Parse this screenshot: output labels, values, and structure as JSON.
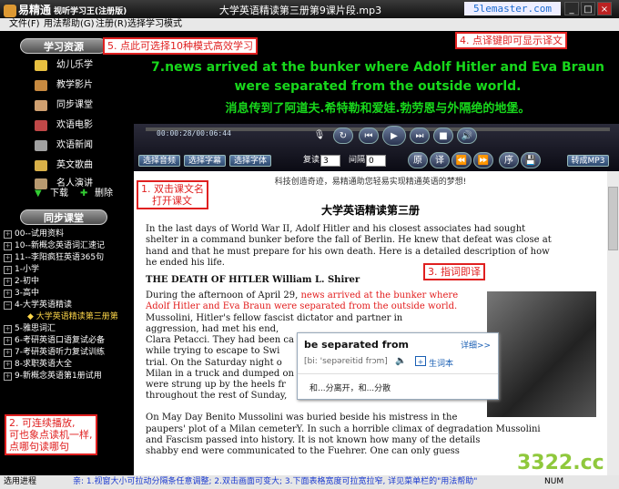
{
  "window": {
    "app_name": "易精通",
    "app_subtitle": "视听学习王(注册版)",
    "title": "大学英语精读第三册第9课片段.mp3",
    "site_badge": "5lemaster.com",
    "min": "_",
    "max": "□",
    "close": "×"
  },
  "menu": [
    "文件(F)",
    "用法帮助(G)",
    "注册(R)",
    "选择学习模式"
  ],
  "sidebar": {
    "learning_header": "学习资源",
    "items": [
      {
        "label": "幼儿乐学",
        "icon": "star-icon"
      },
      {
        "label": "教学影片",
        "icon": "film-icon"
      },
      {
        "label": "同步课堂",
        "icon": "book-icon"
      },
      {
        "label": "欢语电影",
        "icon": "movie-icon"
      },
      {
        "label": "欢语新闻",
        "icon": "news-icon"
      },
      {
        "label": "英文歌曲",
        "icon": "music-icon"
      },
      {
        "label": "名人演讲",
        "icon": "person-icon"
      }
    ],
    "download": "下载",
    "delete": "删除",
    "sync_header": "同步课堂",
    "tree": [
      "00--试用资料",
      "10--新概念英语词汇速记",
      "11--李阳疯狂英语365句",
      "1-小学",
      "2-初中",
      "3-高中",
      "4-大学英语精读",
      "大学英语精读第三册第",
      "5-雅思词汇",
      "6-考研英语口语复试必备",
      "7-考研英语听力复试训练",
      "8-求职英语大全",
      "9-新概念英语第1册试用"
    ]
  },
  "video": {
    "subtitle_en_1": "7.news arrived at the bunker where Adolf Hitler and Eva Braun",
    "subtitle_en_2": "were separated from the outside world.",
    "subtitle_cn": "消息传到了阿道夫.希特勒和爱娃.勃劳恩与外隔绝的地堡。"
  },
  "controls": {
    "time": "00:00:28/00:06:44",
    "btn_audio": "选择音频",
    "btn_subtitle": "选择字幕",
    "btn_font": "选择字体",
    "repeat_label": "复读",
    "repeat_value": "3",
    "interval_label": "间隔",
    "interval_value": "0",
    "original": "原",
    "translate": "译",
    "seq": "序",
    "convert": "转成MP3"
  },
  "content": {
    "slogan": "科技创造奇迹，易精通助您轻易实现精通英语的梦想!",
    "heading": "大学英语精读第三册",
    "lines": [
      "In the last days of World War II, Adolf Hitler and his closest associates had sought",
      "shelter in a command bunker before the fall of Berlin. He knew that defeat was close at",
      "hand and that he must prepare for his own death. Here is a detailed description of how",
      "he ended his life."
    ],
    "section_title": "THE DEATH OF HITLER William L. Shirer",
    "p2_prefix": "During the afternoon of April 29, ",
    "p2_red": "news arrived at the bunker where",
    "p2_red2": "Adolf Hitler and Eva Braun were separated from the outside world.",
    "p2_lines": [
      "Mussolini, Hitler's fellow fascist dictator and partner in",
      "aggression, had met his end,",
      "Clara Petacci. They had been ca",
      "while trying to escape to Swi",
      "trial. On the Saturday night o",
      "Milan in a truck and dumped on",
      "were strung up by the heels fr",
      "throughout the rest of Sunday,"
    ],
    "p3_lines": [
      "On May Day Benito Mussolini was buried beside his mistress in the",
      "paupers' plot of a Milan cemeterY. In such a horrible climax of degradation Mussolini",
      "and Fascism passed into history. It is not known how many of the details",
      "shabby end were communicated to the Fuehrer. One can only guess"
    ]
  },
  "callouts": {
    "c1": [
      "1. 双击课文名",
      "打开课文"
    ],
    "c2": [
      "2. 可连续播放,",
      "可也象点读机一样,",
      "点哪句读哪句"
    ],
    "c3": "3. 指词即译",
    "c4": "4. 点译键即可显示译文",
    "c5": "5. 点此可选择10种模式高效学习"
  },
  "dict": {
    "word": "be separated from",
    "detail": "详细>>",
    "phonetic": "[bi: 'sepəreitid frɔm]",
    "vocab": "生词本",
    "meaning": "和...分离开，和...分散"
  },
  "status": {
    "left": "选用进程",
    "tip": "亲: 1.视窗大小可拉动分隔条任意调整; 2.双击画面可变大; 3.下面表格宽度可拉宽拉窄, 详见菜单栏的\"用法帮助\"",
    "num": "NUM"
  },
  "watermark": "3322.cc",
  "colors": {
    "subtitle": "#18d81c",
    "highlight": "#e21b1b",
    "callout": "#e02020"
  }
}
